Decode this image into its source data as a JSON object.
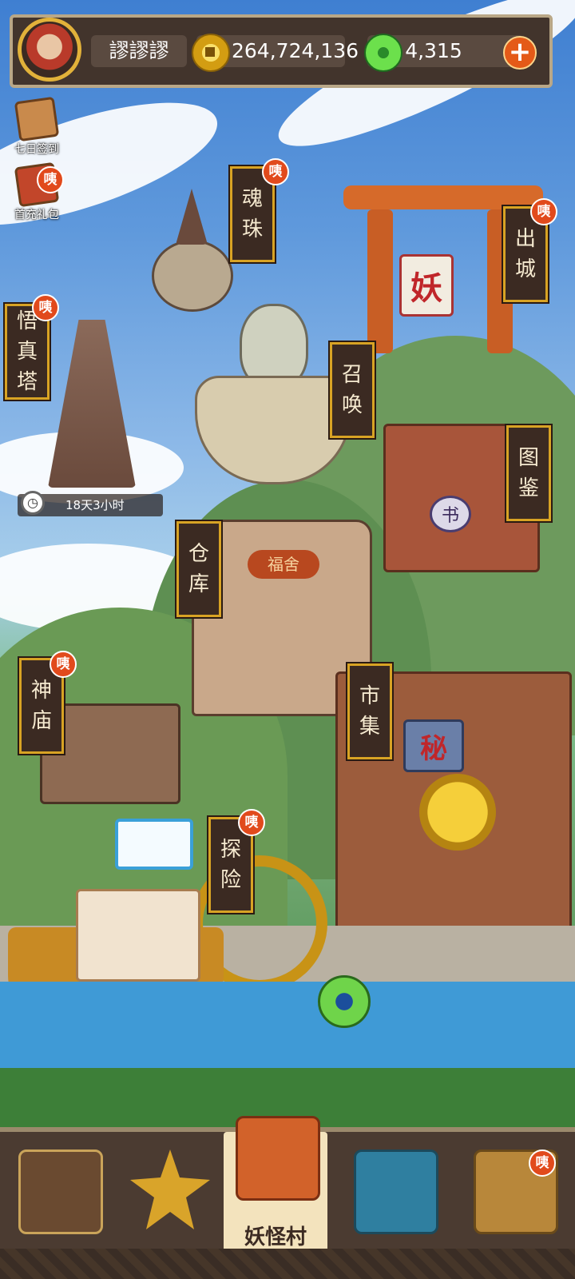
{
  "player": {
    "name": "謬謬謬"
  },
  "currency": {
    "gold": "264,724,136",
    "jade": "4,315"
  },
  "side_menu": [
    {
      "label": "七日签到"
    },
    {
      "label": "首充礼包",
      "badge": "咦"
    }
  ],
  "buildings": [
    {
      "id": "soul-orb",
      "label": [
        "魂",
        "珠"
      ],
      "badge": "咦"
    },
    {
      "id": "exit-city",
      "label": [
        "出",
        "城"
      ],
      "badge": "咦"
    },
    {
      "id": "wisdom-tower",
      "label": [
        "悟",
        "真",
        "塔"
      ],
      "badge": "咦"
    },
    {
      "id": "summon",
      "label": [
        "召",
        "唤"
      ]
    },
    {
      "id": "codex",
      "label": [
        "图",
        "鉴"
      ]
    },
    {
      "id": "warehouse",
      "label": [
        "仓",
        "库"
      ]
    },
    {
      "id": "temple",
      "label": [
        "神",
        "庙"
      ],
      "badge": "咦"
    },
    {
      "id": "market",
      "label": [
        "市",
        "集"
      ]
    },
    {
      "id": "explore",
      "label": [
        "探",
        "险"
      ],
      "badge": "咦"
    }
  ],
  "timer": {
    "text": "18天3小时"
  },
  "map_signs": {
    "fortune": "福舍",
    "secret": "秘",
    "book": "书",
    "demon": "妖"
  },
  "bottom_nav": {
    "active_label": "妖怪村",
    "last_badge": "咦"
  },
  "colors": {
    "label_bg": "#3b2a22",
    "label_border": "#d8a324",
    "badge": "#e14a1c",
    "active_tab": "#f3e3bd"
  }
}
